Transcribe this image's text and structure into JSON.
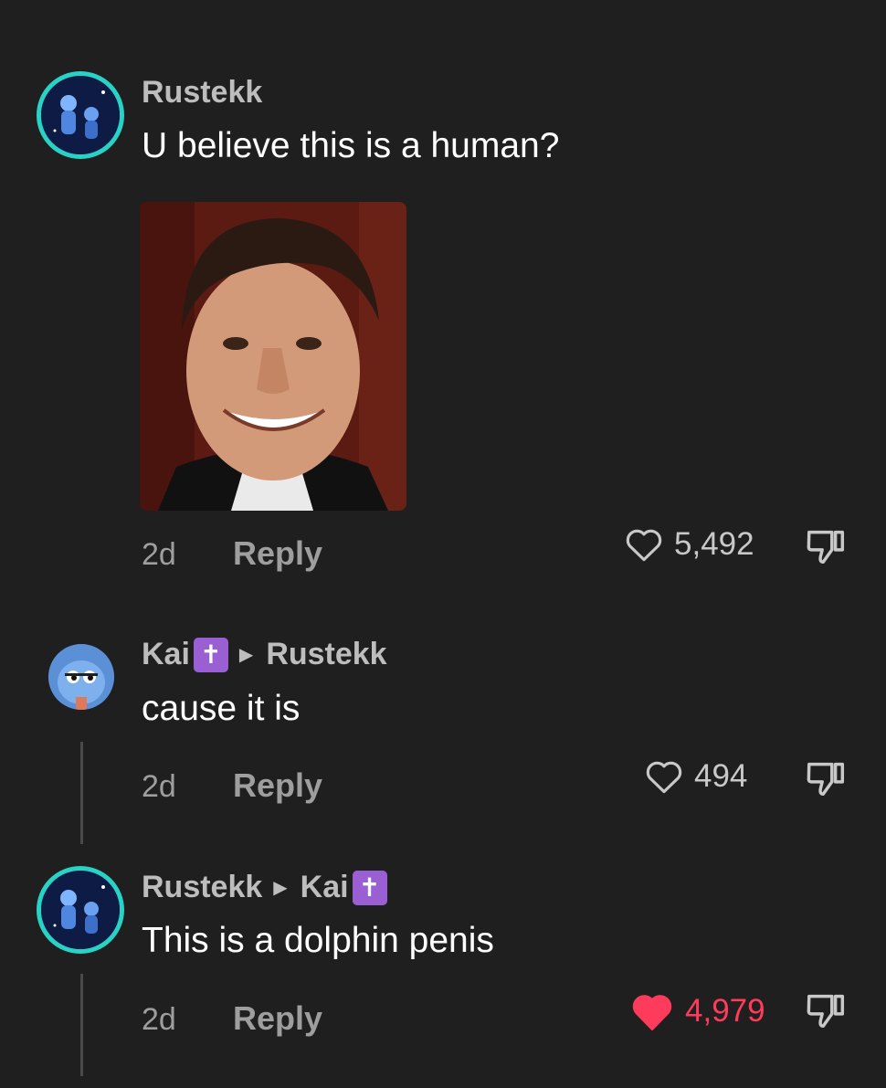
{
  "comments": [
    {
      "author": "Rustekk",
      "text": "U believe this is a human?",
      "age": "2d",
      "reply_label": "Reply",
      "likes": "5,492",
      "liked": false
    },
    {
      "author": "Kai",
      "reply_to": "Rustekk",
      "text": "cause it is",
      "age": "2d",
      "reply_label": "Reply",
      "likes": "494",
      "liked": false
    },
    {
      "author": "Rustekk",
      "reply_to": "Kai",
      "text": "This is a dolphin penis",
      "age": "2d",
      "reply_label": "Reply",
      "likes": "4,979",
      "liked": true
    }
  ],
  "badges": {
    "kai_badge": "✝"
  },
  "icons": {
    "like": "heart-outline-icon",
    "liked": "heart-filled-icon",
    "dislike": "thumbs-down-icon"
  },
  "colors": {
    "background": "#1f1f1f",
    "avatar_ring": "#28d3c6",
    "liked": "#ff3b5c",
    "badge": "#9b5fd4"
  }
}
